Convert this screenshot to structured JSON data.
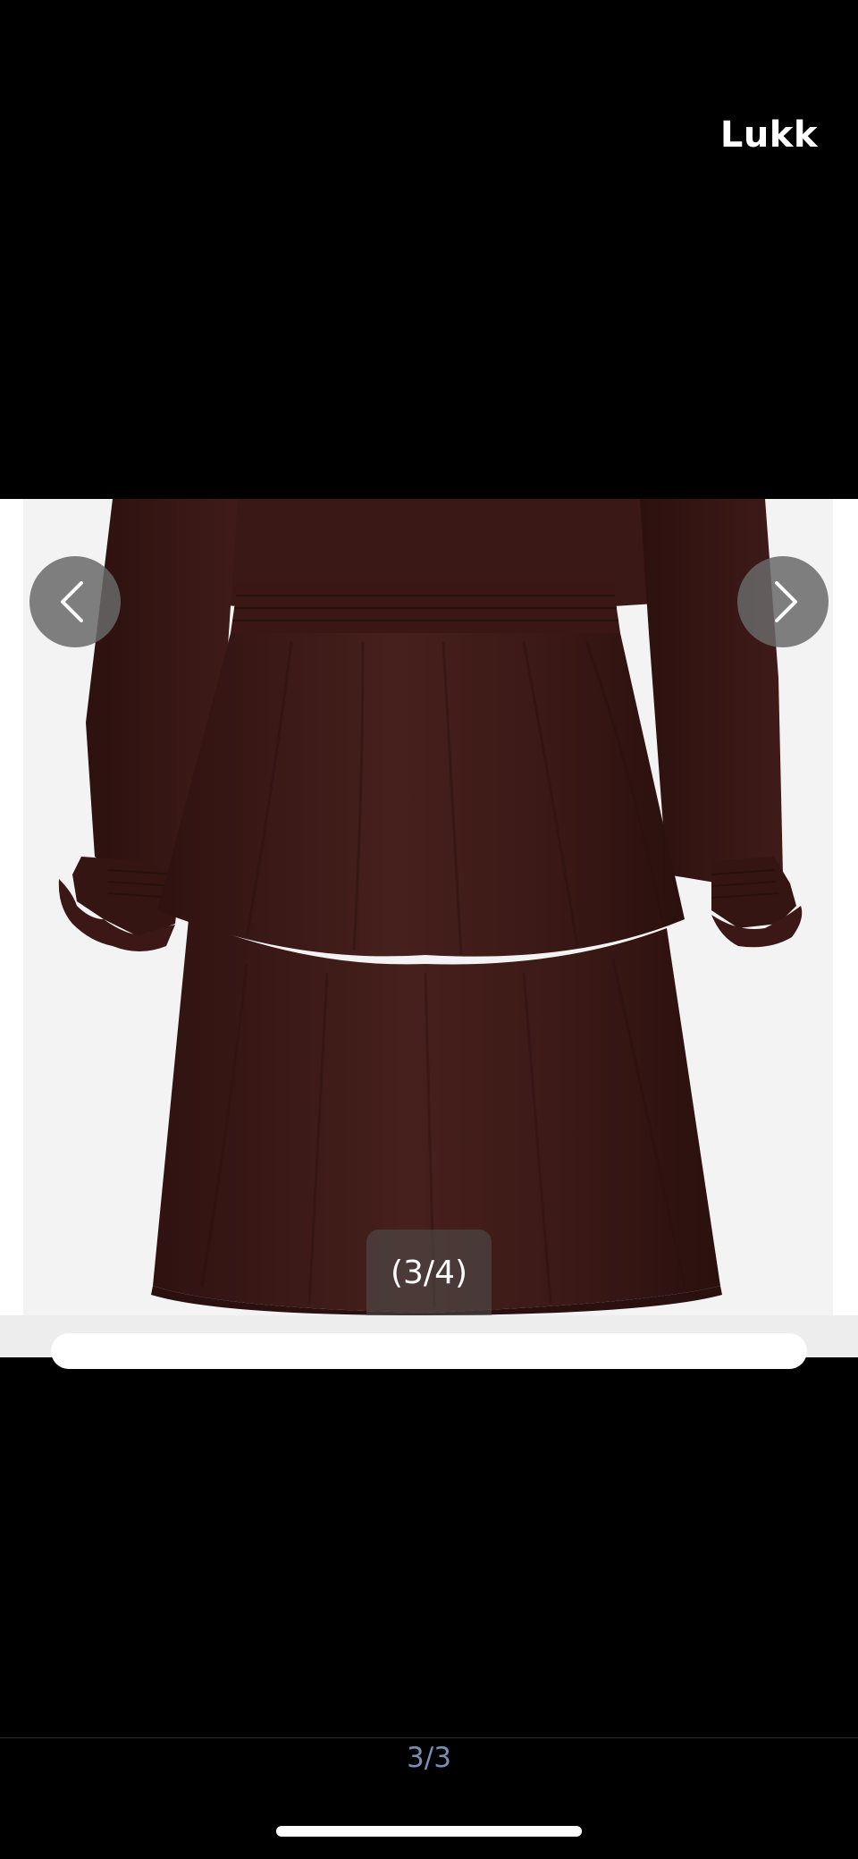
{
  "header": {
    "close_label": "Lukk"
  },
  "viewer": {
    "image_counter": "(3/4)",
    "prev_icon": "chevron-left-icon",
    "next_icon": "chevron-right-icon",
    "photo_subject": "product-photo",
    "colors": {
      "background": "#000000",
      "photo_backdrop": "#f4f3f3",
      "garment": "#3e1a17",
      "nav_button": "#696969"
    }
  },
  "footer": {
    "page_indicator": "3/3",
    "page_indicator_color": "#7b8cb5"
  }
}
